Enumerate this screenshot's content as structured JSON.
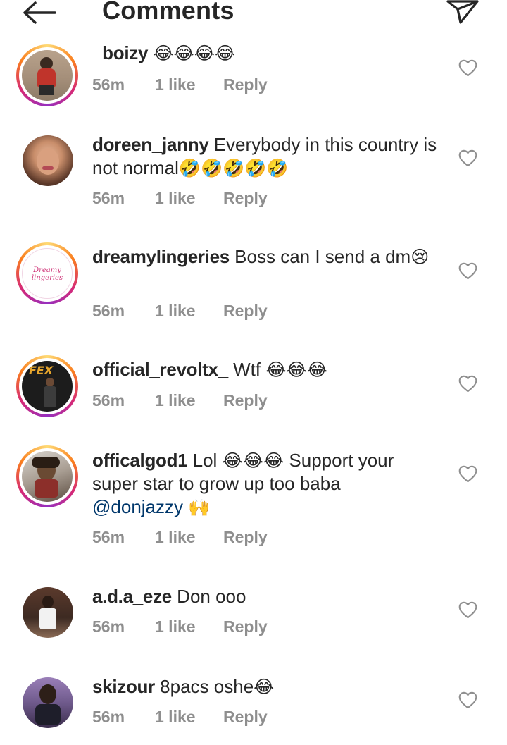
{
  "header": {
    "title": "Comments",
    "back_icon": "arrow-left-icon",
    "send_icon": "paper-plane-icon"
  },
  "colors": {
    "text": "#262626",
    "meta": "#8e8e8e",
    "mention": "#00376b",
    "story_ring": [
      "#feda75",
      "#fa7e1e",
      "#d62976",
      "#962fbf"
    ]
  },
  "comments": [
    {
      "username": "_boizy",
      "text": "",
      "emoji": "😂😂😂😂",
      "time": "56m",
      "likes": "1 like",
      "reply": "Reply",
      "story_ring": true
    },
    {
      "username": "doreen_janny",
      "text": "Everybody in this country is not normal",
      "emoji": "🤣🤣🤣🤣🤣",
      "time": "56m",
      "likes": "1 like",
      "reply": "Reply",
      "story_ring": false
    },
    {
      "username": "dreamylingeries",
      "text": "Boss can I send a dm",
      "emoji": "😢",
      "avatar_text": "Dreamy lingeries",
      "time": "56m",
      "likes": "1 like",
      "reply": "Reply",
      "story_ring": true
    },
    {
      "username": "official_revoltx_",
      "text": "Wtf",
      "emoji": "😂😂😂",
      "avatar_text": "FEX",
      "time": "56m",
      "likes": "1 like",
      "reply": "Reply",
      "story_ring": true
    },
    {
      "username": "officalgod1",
      "text_before": "Lol",
      "emoji": "😂😂😂",
      "text_after": "Support your super star to grow up too baba",
      "mention": "@donjazzy",
      "emoji_end": "🙌",
      "time": "56m",
      "likes": "1 like",
      "reply": "Reply",
      "story_ring": true
    },
    {
      "username": "a.d.a_eze",
      "text": "Don ooo",
      "time": "56m",
      "likes": "1 like",
      "reply": "Reply",
      "story_ring": false
    },
    {
      "username": "skizour",
      "text": "8pacs oshe",
      "emoji": "😂",
      "time": "56m",
      "likes": "1 like",
      "reply": "Reply",
      "story_ring": false
    }
  ]
}
